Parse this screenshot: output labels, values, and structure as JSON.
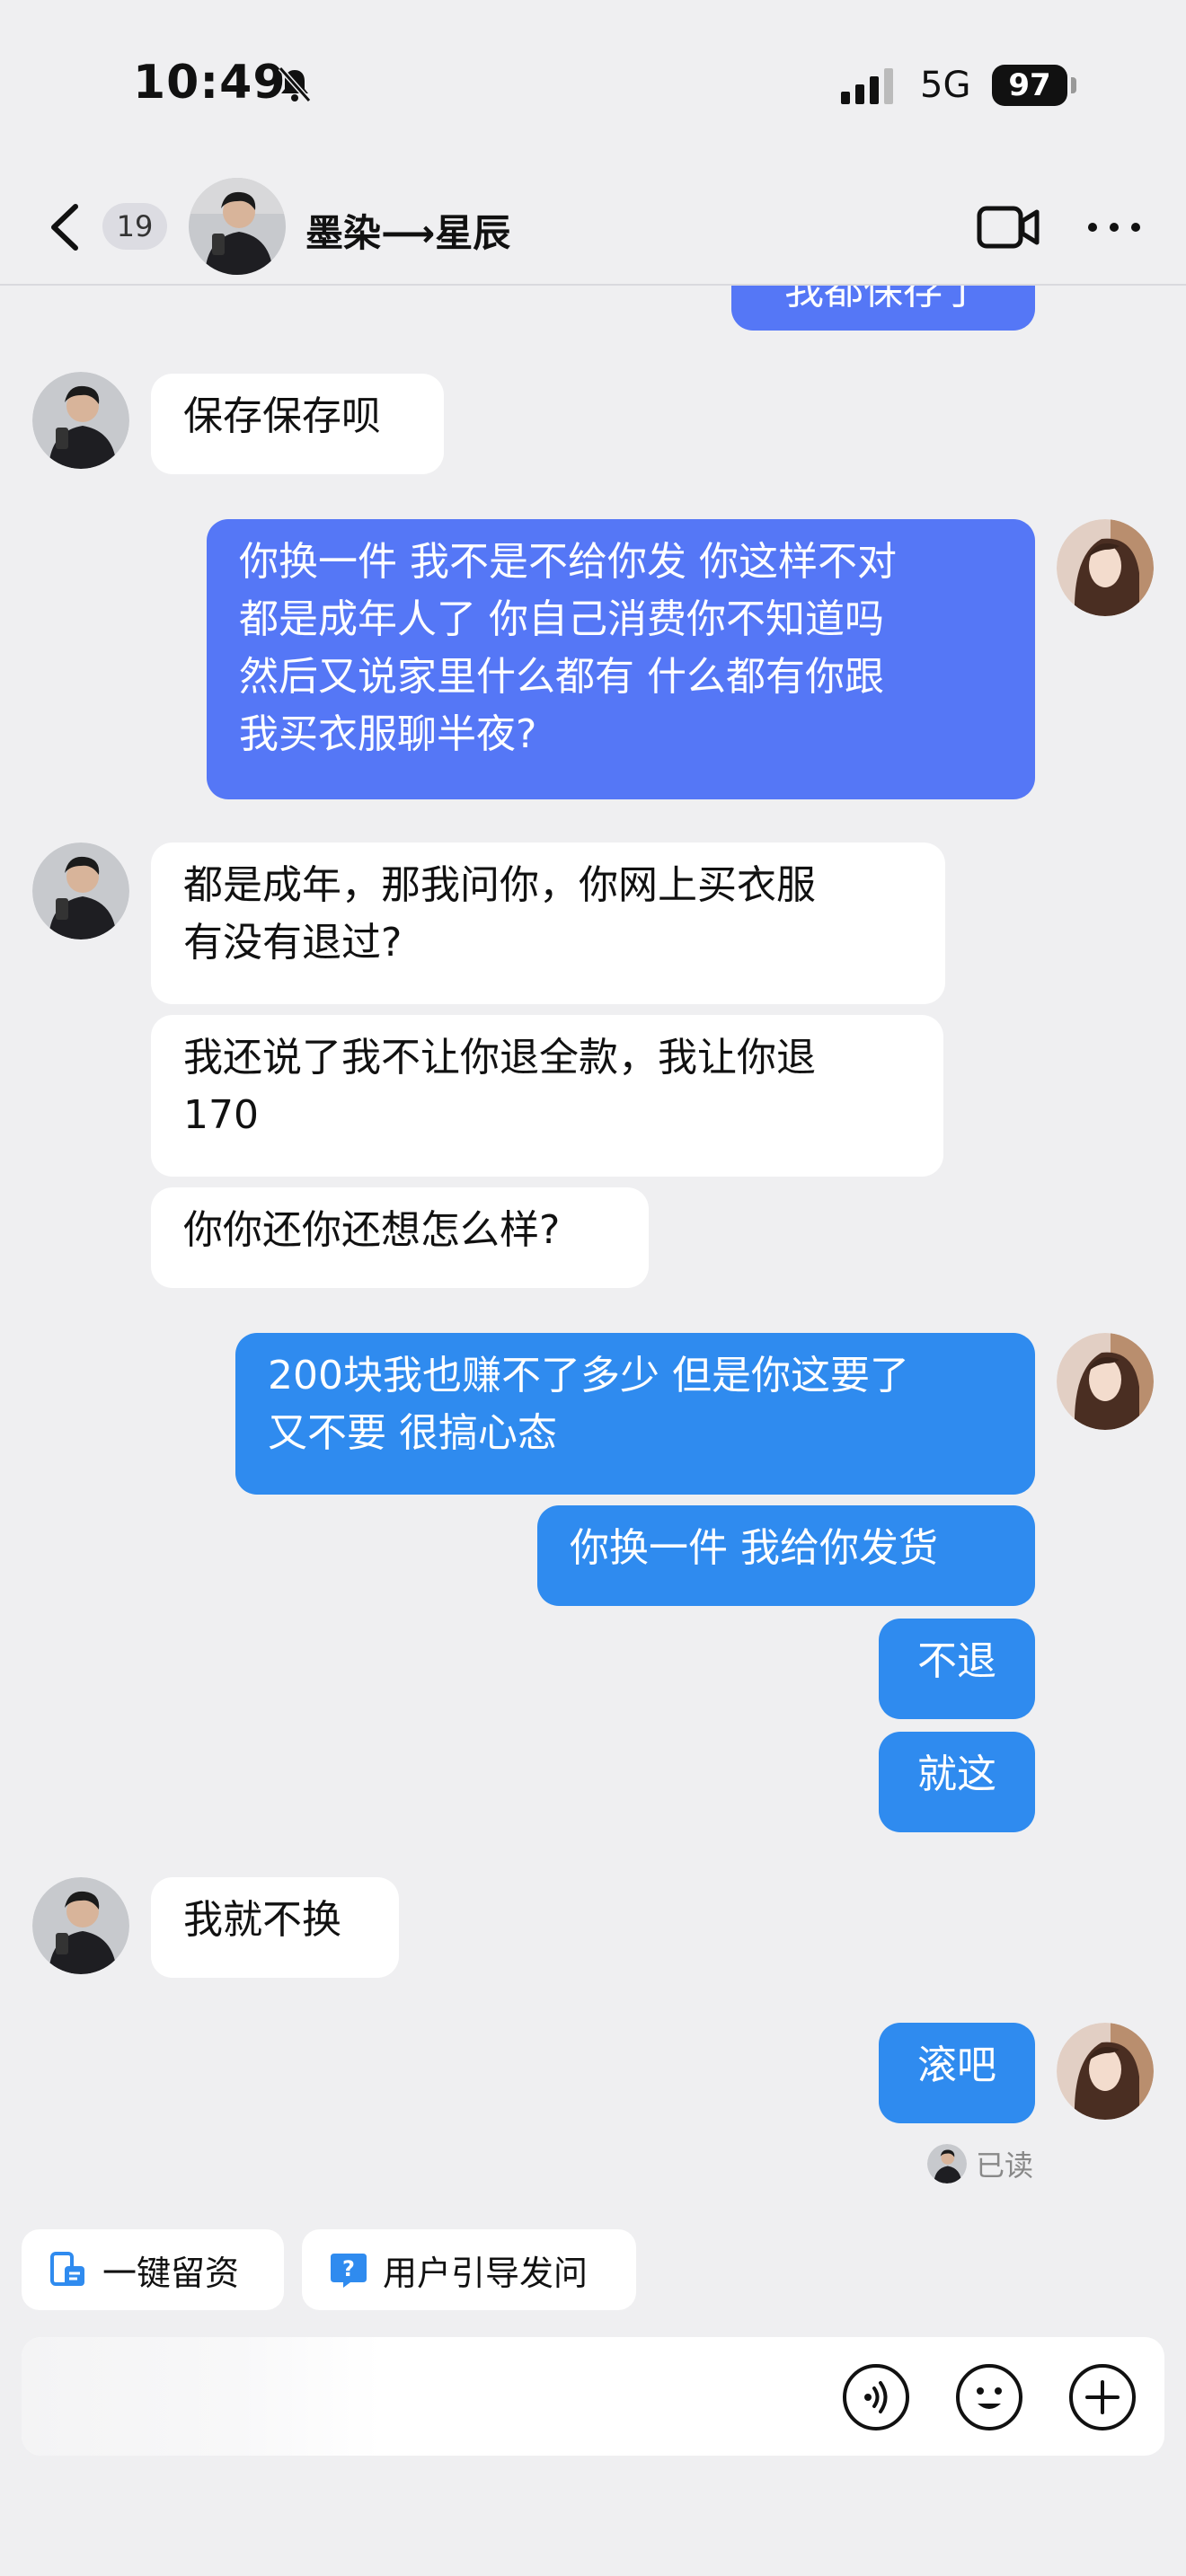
{
  "status_bar": {
    "time": "10:49",
    "network": "5G",
    "battery": "97"
  },
  "header": {
    "unread_count": "19",
    "contact_name": "墨染⟶星辰"
  },
  "messages": [
    {
      "side": "out",
      "color": "purple",
      "text": "我都保存了"
    },
    {
      "side": "in",
      "text": "保存保存呗"
    },
    {
      "side": "out",
      "color": "purple",
      "text": "你换一件 我不是不给你发 你这样不对\n都是成年人了 你自己消费你不知道吗\n然后又说家里什么都有 什么都有你跟\n我买衣服聊半夜?"
    },
    {
      "side": "in",
      "text": "都是成年，那我问你，你网上买衣服\n有没有退过?"
    },
    {
      "side": "in",
      "text": "我还说了我不让你退全款，我让你退\n170"
    },
    {
      "side": "in",
      "text": "你你还你还想怎么样?"
    },
    {
      "side": "out",
      "color": "blue",
      "text": "200块我也赚不了多少 但是你这要了\n又不要 很搞心态"
    },
    {
      "side": "out",
      "color": "blue",
      "text": "你换一件 我给你发货"
    },
    {
      "side": "out",
      "color": "blue",
      "text": "不退"
    },
    {
      "side": "out",
      "color": "blue",
      "text": "就这"
    },
    {
      "side": "in",
      "text": "我就不换"
    },
    {
      "side": "out",
      "color": "blue",
      "text": "滚吧"
    }
  ],
  "read_receipt": "已读",
  "quick_actions": [
    {
      "label": "一键留资",
      "icon": "phone-form-icon"
    },
    {
      "label": "用户引导发问",
      "icon": "question-icon"
    }
  ],
  "input": {
    "placeholder": ""
  },
  "colors": {
    "background": "#efeff1",
    "outgoing_purple": "#5577f6",
    "outgoing_blue": "#2f8bef",
    "incoming": "#ffffff",
    "accent": "#2f8bef"
  }
}
